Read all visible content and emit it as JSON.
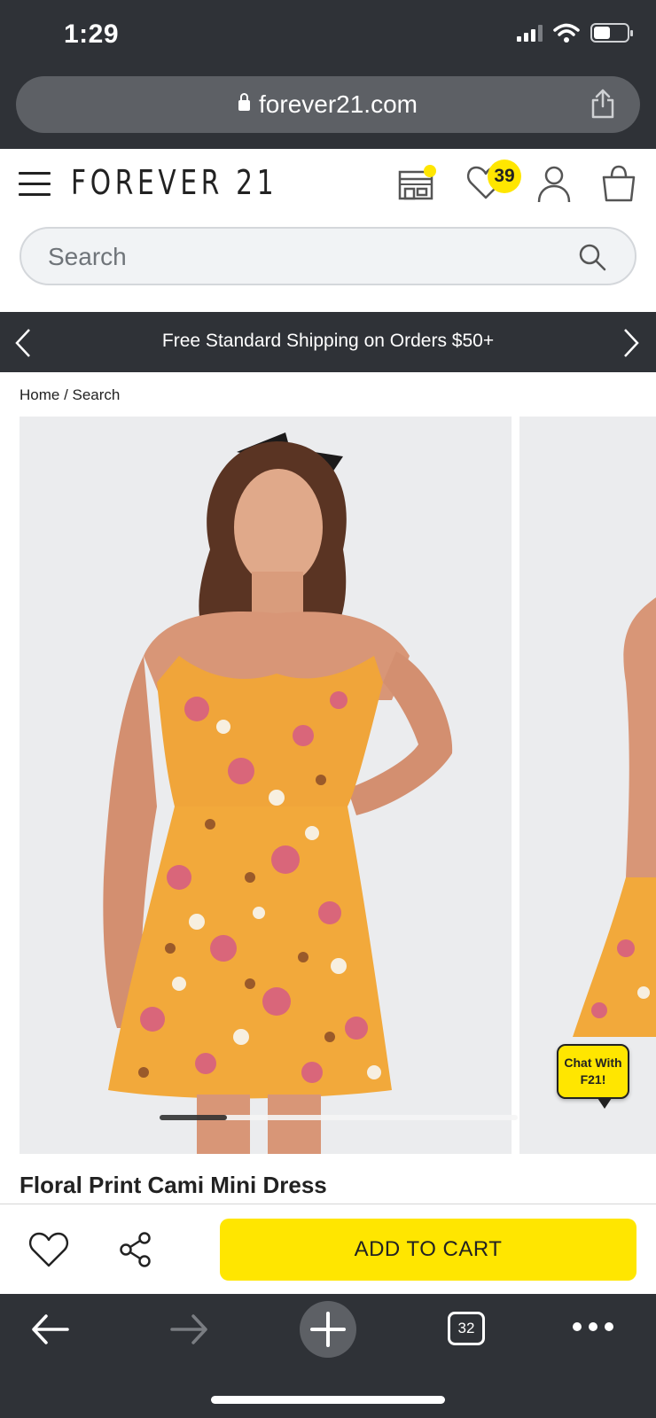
{
  "status_bar": {
    "time": "1:29"
  },
  "browser": {
    "url": "forever21.com",
    "tabs_count": "32"
  },
  "header": {
    "brand": "FOREVER 21",
    "wishlist_count": "39"
  },
  "search": {
    "placeholder": "Search"
  },
  "promo": {
    "text": "Free Standard Shipping on Orders $50+"
  },
  "breadcrumb": {
    "text": "Home / Search"
  },
  "chat": {
    "label_line1": "Chat With",
    "label_line2": "F21!"
  },
  "product": {
    "title": "Floral Print Cami Mini Dress",
    "add_to_cart": "ADD TO CART"
  },
  "colors": {
    "accent_yellow": "#ffe600",
    "chrome_dark": "#2f3237",
    "url_pill": "#5d6065"
  },
  "icons": [
    "lock-icon",
    "share-icon",
    "hamburger-icon",
    "store-icon",
    "heart-icon",
    "account-icon",
    "bag-icon",
    "search-icon",
    "chevron-left-icon",
    "chevron-right-icon",
    "back-arrow-icon",
    "forward-arrow-icon",
    "plus-icon",
    "tabs-icon",
    "more-icon"
  ]
}
